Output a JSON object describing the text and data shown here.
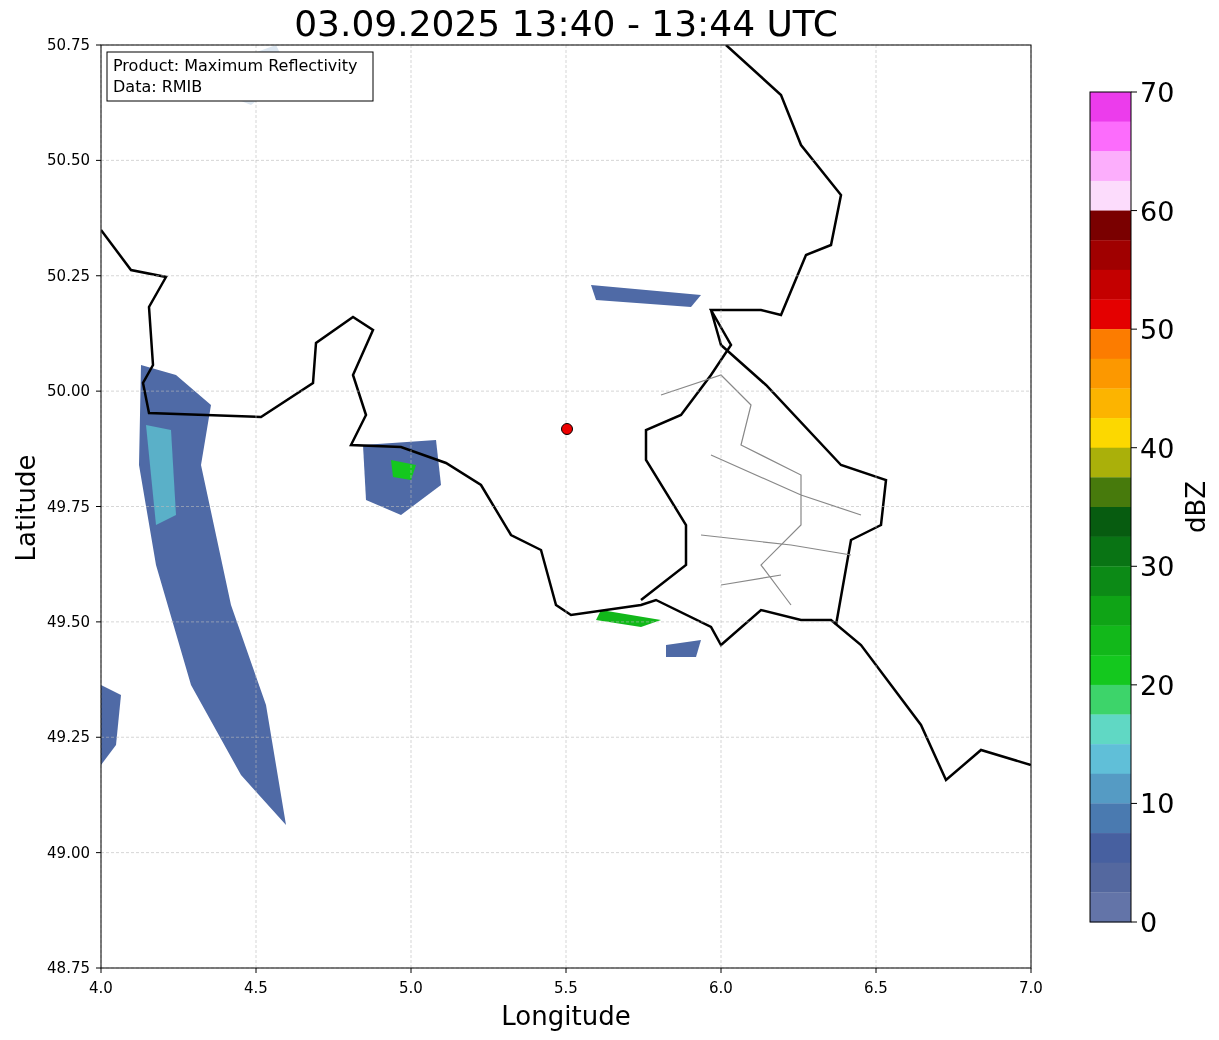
{
  "title": "03.09.2025 13:40 - 13:44 UTC",
  "info_box": [
    "Product: Maximum Reflectivity",
    "Data: RMIB"
  ],
  "xaxis": {
    "label": "Longitude",
    "ticks": [
      "4.0",
      "4.5",
      "5.0",
      "5.5",
      "6.0",
      "6.5",
      "7.0"
    ]
  },
  "yaxis": {
    "label": "Latitude",
    "ticks": [
      "50.75",
      "50.50",
      "50.25",
      "50.00",
      "49.75",
      "49.50",
      "49.25",
      "49.00",
      "48.75"
    ]
  },
  "colorbar": {
    "label": "dBZ",
    "ticks": [
      "70",
      "60",
      "50",
      "40",
      "30",
      "20",
      "10",
      "0"
    ],
    "bins": [
      {
        "color": "#ec3cec"
      },
      {
        "color": "#fc6cfc"
      },
      {
        "color": "#fcaefc"
      },
      {
        "color": "#fcdcfc"
      },
      {
        "color": "#7a0000"
      },
      {
        "color": "#a00000"
      },
      {
        "color": "#c40000"
      },
      {
        "color": "#e40000"
      },
      {
        "color": "#fc7c00"
      },
      {
        "color": "#fc9800"
      },
      {
        "color": "#fcb400"
      },
      {
        "color": "#fcd800"
      },
      {
        "color": "#aab00a"
      },
      {
        "color": "#477a0c"
      },
      {
        "color": "#075c10"
      },
      {
        "color": "#097414"
      },
      {
        "color": "#0c8a16"
      },
      {
        "color": "#0fa416"
      },
      {
        "color": "#12b81a"
      },
      {
        "color": "#14c81e"
      },
      {
        "color": "#3dd46a"
      },
      {
        "color": "#60d8c4"
      },
      {
        "color": "#60bfd8"
      },
      {
        "color": "#559bc4"
      },
      {
        "color": "#4a7ab0"
      },
      {
        "color": "#4760a0"
      },
      {
        "color": "#54689f"
      },
      {
        "color": "#6374a8"
      }
    ]
  }
}
